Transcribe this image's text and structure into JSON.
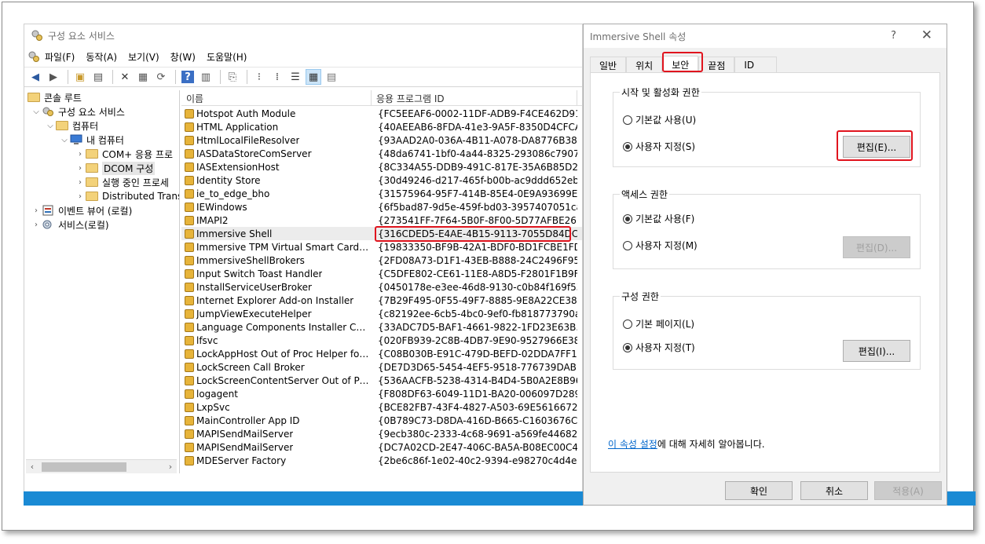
{
  "mmc": {
    "title": "구성 요소 서비스",
    "menu": [
      "파일(F)",
      "동작(A)",
      "보기(V)",
      "창(W)",
      "도움말(H)"
    ],
    "tree": [
      {
        "label": "콘솔 루트",
        "depth": 0,
        "expander": ""
      },
      {
        "label": "구성 요소 서비스",
        "depth": 1,
        "expander": "v"
      },
      {
        "label": "컴퓨터",
        "depth": 2,
        "expander": "v"
      },
      {
        "label": "내 컴퓨터",
        "depth": 3,
        "expander": "v"
      },
      {
        "label": "COM+ 응용 프로",
        "depth": 4,
        "expander": ">"
      },
      {
        "label": "DCOM 구성",
        "depth": 4,
        "expander": ">"
      },
      {
        "label": "실행 중인 프로세",
        "depth": 4,
        "expander": ">"
      },
      {
        "label": "Distributed Trans",
        "depth": 4,
        "expander": ">"
      },
      {
        "label": "이벤트 뷰어 (로컬)",
        "depth": 1,
        "expander": ">"
      },
      {
        "label": "서비스(로컬)",
        "depth": 1,
        "expander": ">"
      }
    ],
    "columns": [
      "이름",
      "응용 프로그램 ID"
    ],
    "rows": [
      {
        "name": "Hotspot Auth Module",
        "id": "{FC5EEAF6-0002-11DF-ADB9-F4CE462D91..."
      },
      {
        "name": "HTML Application",
        "id": "{40AEEAB6-8FDA-41e3-9A5F-8350D4CFCA..."
      },
      {
        "name": "HtmlLocalFileResolver",
        "id": "{93AAD2A0-036A-4B11-A078-DA8776B38..."
      },
      {
        "name": "IASDataStoreComServer",
        "id": "{48da6741-1bf0-4a44-8325-293086c79077}"
      },
      {
        "name": "IASExtensionHost",
        "id": "{8C334A55-DDB9-491C-817E-35A6B85D2..."
      },
      {
        "name": "Identity Store",
        "id": "{30d49246-d217-465f-b00b-ac9ddd652eb7}"
      },
      {
        "name": "ie_to_edge_bho",
        "id": "{31575964-95F7-414B-85E4-0E9A93699E1..."
      },
      {
        "name": "IEWindows",
        "id": "{6f5bad87-9d5e-459f-bd03-3957407051ca}"
      },
      {
        "name": "IMAPI2",
        "id": "{273541FF-7F64-5B0F-8F00-5D77AFBE261E}"
      },
      {
        "name": "Immersive Shell",
        "id": "{316CDED5-E4AE-4B15-9113-7055D84DC..."
      },
      {
        "name": "Immersive TPM Virtual Smart Card Ma...",
        "id": "{19833350-BF9B-42A1-BDF0-BD1FCBE1FD..."
      },
      {
        "name": "ImmersiveShellBrokers",
        "id": "{2FD08A73-D1F1-43EB-B888-24C2496F95..."
      },
      {
        "name": "Input Switch Toast Handler",
        "id": "{C5DFE802-CE61-11E8-A8D5-F2801F1B9F..."
      },
      {
        "name": "InstallServiceUserBroker",
        "id": "{0450178e-e3ee-46d8-9130-c0b84f169f53}"
      },
      {
        "name": "Internet Explorer Add-on Installer",
        "id": "{7B29F495-0F55-49F7-8885-9E8A22CE382..."
      },
      {
        "name": "JumpViewExecuteHelper",
        "id": "{c82192ee-6cb5-4bc0-9ef0-fb818773790a}"
      },
      {
        "name": "Language Components Installer Com ...",
        "id": "{33ADC7D5-BAF1-4661-9822-1FD23E63B..."
      },
      {
        "name": "lfsvc",
        "id": "{020FB939-2C8B-4DB7-9E90-9527966E38..."
      },
      {
        "name": "LockAppHost Out of Proc Helper for L...",
        "id": "{C08B030B-E91C-479D-BEFD-02DDA7FF1..."
      },
      {
        "name": "LockScreen Call Broker",
        "id": "{DE7D3D65-5454-4EF5-9518-776739DAB..."
      },
      {
        "name": "LockScreenContentServer Out of Proc ...",
        "id": "{536AACFB-5238-4314-B4D4-5B0A2E8B96..."
      },
      {
        "name": "logagent",
        "id": "{F808DF63-6049-11D1-BA20-006097D289..."
      },
      {
        "name": "LxpSvc",
        "id": "{BCE82FB7-43F4-4827-A503-69E56166729..."
      },
      {
        "name": "MainController App ID",
        "id": "{0B789C73-D8DA-416D-B665-C1603676C..."
      },
      {
        "name": "MAPISendMailServer",
        "id": "{9ecb380c-2333-4c68-9691-a569fe446820}"
      },
      {
        "name": "MAPISendMailServer",
        "id": "{DC7A02CD-2E47-406C-BA5A-B08EC00C4..."
      },
      {
        "name": "MDEServer Factory",
        "id": "{2be6c86f-1e02-40c2-9394-e98270c4d4e6}"
      }
    ]
  },
  "dialog": {
    "title": "Immersive Shell 속성",
    "help": "?",
    "close": "✕",
    "tabs": [
      "일반",
      "위치",
      "보안",
      "끝점",
      "ID"
    ],
    "launch": {
      "title": "시작 및 활성화 권한",
      "default": "기본값 사용(U)",
      "custom": "사용자 지정(S)",
      "edit": "편집(E)..."
    },
    "access": {
      "title": "액세스 권한",
      "default": "기본값 사용(F)",
      "custom": "사용자 지정(M)",
      "edit": "편집(D)..."
    },
    "config": {
      "title": "구성 권한",
      "default": "기본 페이지(L)",
      "custom": "사용자 지정(T)",
      "edit": "편집(I)..."
    },
    "learn_link": "이 속성 설정",
    "learn_rest": "에 대해 자세히 알아봅니다.",
    "ok": "확인",
    "cancel": "취소",
    "apply": "적용(A)"
  },
  "colors": {
    "highlight": "#e0141e",
    "accent": "#1a8ad4",
    "link": "#0066cc"
  }
}
